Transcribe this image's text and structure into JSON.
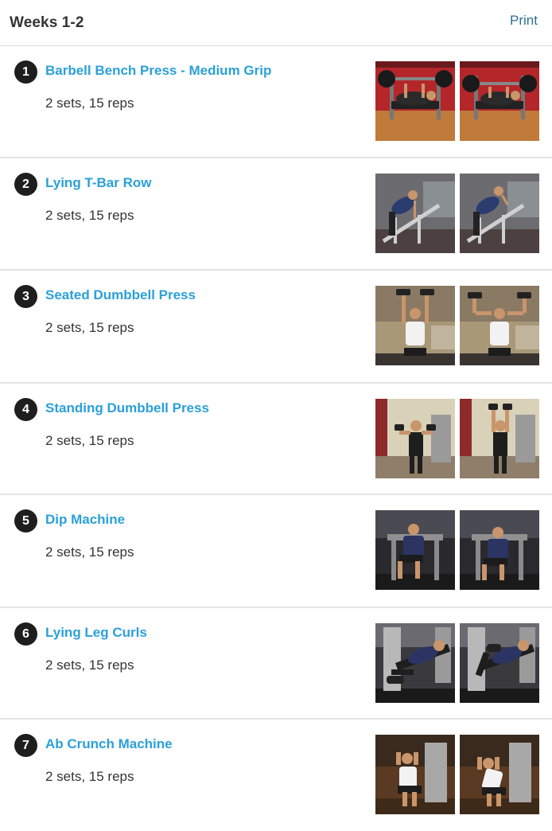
{
  "header": {
    "title": "Weeks 1-2",
    "print_label": "Print"
  },
  "exercises": [
    {
      "number": "1",
      "name": "Barbell Bench Press - Medium Grip",
      "detail": "2 sets, 15 reps",
      "scene": "bench"
    },
    {
      "number": "2",
      "name": "Lying T-Bar Row",
      "detail": "2 sets, 15 reps",
      "scene": "tbar"
    },
    {
      "number": "3",
      "name": "Seated Dumbbell Press",
      "detail": "2 sets, 15 reps",
      "scene": "seated"
    },
    {
      "number": "4",
      "name": "Standing Dumbbell Press",
      "detail": "2 sets, 15 reps",
      "scene": "standing"
    },
    {
      "number": "5",
      "name": "Dip Machine",
      "detail": "2 sets, 15 reps",
      "scene": "dip"
    },
    {
      "number": "6",
      "name": "Lying Leg Curls",
      "detail": "2 sets, 15 reps",
      "scene": "legcurl"
    },
    {
      "number": "7",
      "name": "Ab Crunch Machine",
      "detail": "2 sets, 15 reps",
      "scene": "abcrunch"
    }
  ],
  "colors": {
    "link": "#2ba0d8",
    "print_link": "#2d6e94",
    "badge": "#1e1e1e",
    "divider": "#e4e4e4"
  }
}
